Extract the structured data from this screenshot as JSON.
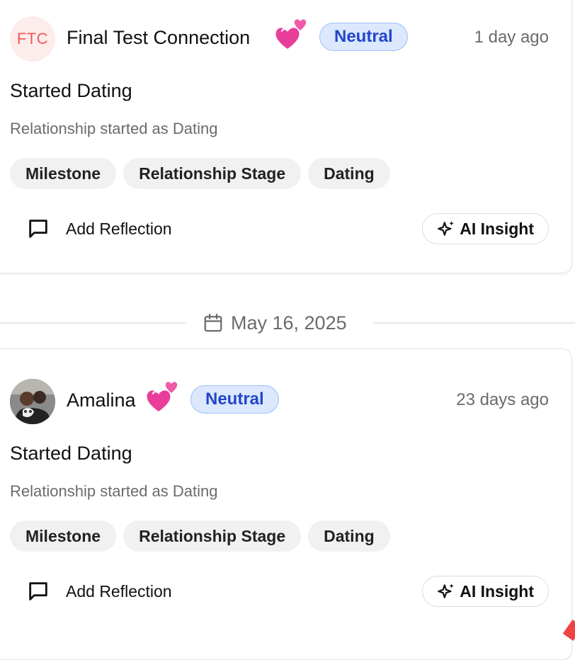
{
  "timeline": {
    "entries": [
      {
        "avatar_initials": "FTC",
        "name": "Final Test Connection",
        "emoji_icon": "two-hearts-emoji",
        "sentiment": "Neutral",
        "time_ago": "1 day ago",
        "title": "Started Dating",
        "description": "Relationship started as Dating",
        "tags": [
          "Milestone",
          "Relationship Stage",
          "Dating"
        ],
        "reflection_label": "Add Reflection",
        "insight_label": "AI Insight"
      },
      {
        "avatar_initials": "",
        "name": "Amalina",
        "emoji_icon": "two-hearts-emoji",
        "sentiment": "Neutral",
        "time_ago": "23 days ago",
        "title": "Started Dating",
        "description": "Relationship started as Dating",
        "tags": [
          "Milestone",
          "Relationship Stage",
          "Dating"
        ],
        "reflection_label": "Add Reflection",
        "insight_label": "AI Insight"
      }
    ],
    "date_separator": "May 16, 2025"
  },
  "colors": {
    "badge_bg": "#dbe8fd",
    "badge_text": "#2346c9",
    "avatar_initials_bg": "#fdecec",
    "avatar_initials_text": "#ef5a5a",
    "tag_bg": "#f1f1f2",
    "muted_text": "#6b6b6b"
  }
}
